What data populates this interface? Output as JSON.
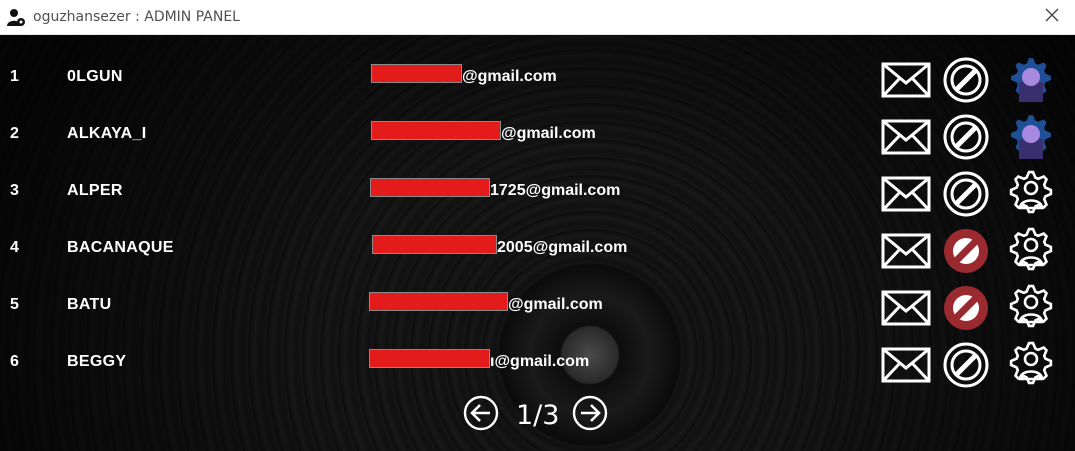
{
  "window": {
    "title": "oguzhansezer : ADMIN PANEL",
    "app_icon": "user-gear-icon",
    "close_icon": "close-icon"
  },
  "users": [
    {
      "num": "1",
      "username": "0LGUN",
      "email_suffix": "@gmail.com",
      "ban_status": "inactive",
      "role_icon": "admin"
    },
    {
      "num": "2",
      "username": "ALKAYA_I",
      "email_suffix": "@gmail.com",
      "ban_status": "inactive",
      "role_icon": "admin"
    },
    {
      "num": "3",
      "username": "ALPER",
      "email_suffix": "1725@gmail.com",
      "ban_status": "inactive",
      "role_icon": "user"
    },
    {
      "num": "4",
      "username": "BACANAQUE",
      "email_suffix": "2005@gmail.com",
      "ban_status": "banned",
      "role_icon": "user"
    },
    {
      "num": "5",
      "username": "BATU",
      "email_suffix": "@gmail.com",
      "ban_status": "banned",
      "role_icon": "user"
    },
    {
      "num": "6",
      "username": "BEGGY",
      "email_suffix": "ı@gmail.com",
      "ban_status": "inactive",
      "role_icon": "user"
    }
  ],
  "pagination": {
    "label": "1/3",
    "prev_icon": "arrow-left-circle-icon",
    "next_icon": "arrow-right-circle-icon"
  },
  "colors": {
    "redaction": "#e31b1b",
    "banned": "#9b2a30",
    "admin_gear": "#1f4f97",
    "admin_accent": "#a78ae0"
  }
}
